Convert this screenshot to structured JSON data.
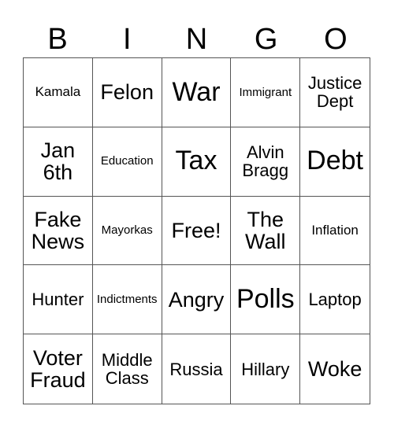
{
  "header": [
    "B",
    "I",
    "N",
    "G",
    "O"
  ],
  "cells": [
    {
      "text": "Kamala",
      "size": "s-s"
    },
    {
      "text": "Felon",
      "size": "s-l"
    },
    {
      "text": "War",
      "size": "s-xl"
    },
    {
      "text": "Immigrant",
      "size": "s-xs"
    },
    {
      "text": "Justice Dept",
      "size": "s-m"
    },
    {
      "text": "Jan 6th",
      "size": "s-l"
    },
    {
      "text": "Education",
      "size": "s-xs"
    },
    {
      "text": "Tax",
      "size": "s-xl"
    },
    {
      "text": "Alvin Bragg",
      "size": "s-m"
    },
    {
      "text": "Debt",
      "size": "s-xl"
    },
    {
      "text": "Fake News",
      "size": "s-l"
    },
    {
      "text": "Mayorkas",
      "size": "s-xs"
    },
    {
      "text": "Free!",
      "size": "s-l"
    },
    {
      "text": "The Wall",
      "size": "s-l"
    },
    {
      "text": "Inflation",
      "size": "s-s"
    },
    {
      "text": "Hunter",
      "size": "s-m"
    },
    {
      "text": "Indictments",
      "size": "s-xs"
    },
    {
      "text": "Angry",
      "size": "s-l"
    },
    {
      "text": "Polls",
      "size": "s-xl"
    },
    {
      "text": "Laptop",
      "size": "s-m"
    },
    {
      "text": "Voter Fraud",
      "size": "s-l"
    },
    {
      "text": "Middle Class",
      "size": "s-m"
    },
    {
      "text": "Russia",
      "size": "s-m"
    },
    {
      "text": "Hillary",
      "size": "s-m"
    },
    {
      "text": "Woke",
      "size": "s-l"
    }
  ]
}
